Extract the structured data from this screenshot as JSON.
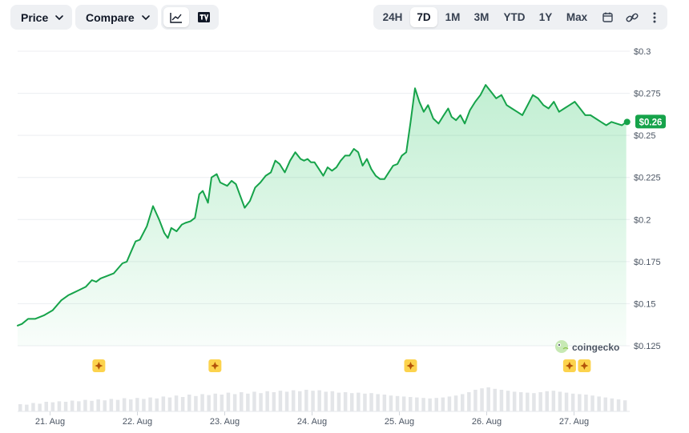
{
  "toolbar": {
    "price_label": "Price",
    "compare_label": "Compare",
    "ranges": [
      "24H",
      "7D",
      "1M",
      "3M",
      "YTD",
      "1Y",
      "Max"
    ],
    "active_range": "7D"
  },
  "icons": [
    "chevron-down-icon",
    "line-chart-icon",
    "tradingview-icon",
    "calendar-icon",
    "link-icon",
    "more-vertical-icon",
    "coingecko-logo-icon",
    "event-star-icon"
  ],
  "colors": {
    "line": "#16a34a",
    "fill": "#22c55e",
    "badge": "#16a34a"
  },
  "watermark": "coingecko",
  "current_price_label": "$0.26",
  "chart_data": {
    "type": "area",
    "ylim": [
      0.125,
      0.3
    ],
    "y_ticks": [
      {
        "value": 0.3,
        "label": "$0.3"
      },
      {
        "value": 0.275,
        "label": "$0.275"
      },
      {
        "value": 0.25,
        "label": "$0.25"
      },
      {
        "value": 0.225,
        "label": "$0.225"
      },
      {
        "value": 0.2,
        "label": "$0.2"
      },
      {
        "value": 0.175,
        "label": "$0.175"
      },
      {
        "value": 0.15,
        "label": "$0.15"
      },
      {
        "value": 0.125,
        "label": "$0.125"
      }
    ],
    "x_ticks": [
      {
        "value": 0.5,
        "label": "21. Aug"
      },
      {
        "value": 1.5,
        "label": "22. Aug"
      },
      {
        "value": 2.5,
        "label": "23. Aug"
      },
      {
        "value": 3.5,
        "label": "24. Aug"
      },
      {
        "value": 4.5,
        "label": "25. Aug"
      },
      {
        "value": 5.5,
        "label": "26. Aug"
      },
      {
        "value": 6.5,
        "label": "27. Aug"
      }
    ],
    "xlim": [
      0,
      7.0
    ],
    "series": [
      {
        "x": [
          0,
          0.05,
          0.12,
          0.2,
          0.3,
          0.4,
          0.5,
          0.58,
          0.62,
          0.7,
          0.78,
          0.85,
          0.9,
          0.95,
          1.0,
          1.05,
          1.1,
          1.2,
          1.25,
          1.3,
          1.35,
          1.4,
          1.48,
          1.55,
          1.62,
          1.68,
          1.72,
          1.76,
          1.82,
          1.88,
          1.92,
          1.98,
          2.03,
          2.08,
          2.12,
          2.18,
          2.22,
          2.28,
          2.32,
          2.36,
          2.4,
          2.45,
          2.5,
          2.55,
          2.6,
          2.66,
          2.72,
          2.78,
          2.84,
          2.9,
          2.95,
          3.0,
          3.06,
          3.12,
          3.18,
          3.24,
          3.28,
          3.32,
          3.36,
          3.4,
          3.45,
          3.5,
          3.55,
          3.6,
          3.65,
          3.7,
          3.75,
          3.8,
          3.85,
          3.9,
          3.95,
          4.0,
          4.05,
          4.1,
          4.15,
          4.2,
          4.25,
          4.3,
          4.35,
          4.4,
          4.45,
          4.5,
          4.55,
          4.6,
          4.65,
          4.7,
          4.76,
          4.82,
          4.88,
          4.93,
          4.97,
          5.02,
          5.07,
          5.12,
          5.18,
          5.24,
          5.3,
          5.36,
          5.42,
          5.48,
          5.54,
          5.6,
          5.66,
          5.72,
          5.78,
          5.84,
          5.9,
          5.96,
          6.02,
          6.08,
          6.14,
          6.2,
          6.26,
          6.32,
          6.38,
          6.44,
          6.5,
          6.56,
          6.62,
          6.68,
          6.74,
          6.8,
          6.86,
          6.92,
          6.97
        ],
        "y": [
          0.137,
          0.138,
          0.141,
          0.141,
          0.143,
          0.146,
          0.152,
          0.155,
          0.156,
          0.158,
          0.16,
          0.164,
          0.163,
          0.165,
          0.166,
          0.167,
          0.168,
          0.174,
          0.175,
          0.181,
          0.187,
          0.188,
          0.196,
          0.208,
          0.2,
          0.192,
          0.189,
          0.195,
          0.193,
          0.197,
          0.198,
          0.199,
          0.201,
          0.215,
          0.217,
          0.21,
          0.225,
          0.227,
          0.222,
          0.221,
          0.22,
          0.223,
          0.221,
          0.214,
          0.207,
          0.211,
          0.219,
          0.222,
          0.226,
          0.228,
          0.235,
          0.233,
          0.228,
          0.235,
          0.24,
          0.236,
          0.235,
          0.236,
          0.234,
          0.234,
          0.23,
          0.226,
          0.231,
          0.229,
          0.231,
          0.235,
          0.238,
          0.238,
          0.242,
          0.24,
          0.232,
          0.236,
          0.23,
          0.226,
          0.224,
          0.224,
          0.228,
          0.232,
          0.233,
          0.238,
          0.24,
          0.258,
          0.278,
          0.27,
          0.264,
          0.268,
          0.26,
          0.257,
          0.262,
          0.266,
          0.261,
          0.259,
          0.262,
          0.257,
          0.265,
          0.27,
          0.274,
          0.28,
          0.276,
          0.272,
          0.274,
          0.268,
          0.266,
          0.264,
          0.262,
          0.268,
          0.274,
          0.272,
          0.268,
          0.266,
          0.27,
          0.264,
          0.266,
          0.268,
          0.27,
          0.266,
          0.262,
          0.262,
          0.26,
          0.258,
          0.256,
          0.258,
          0.257,
          0.256,
          0.258
        ]
      }
    ],
    "volume": [
      0.3,
      0.28,
      0.35,
      0.32,
      0.4,
      0.38,
      0.42,
      0.4,
      0.45,
      0.42,
      0.48,
      0.44,
      0.5,
      0.46,
      0.52,
      0.48,
      0.55,
      0.5,
      0.56,
      0.52,
      0.58,
      0.54,
      0.62,
      0.58,
      0.66,
      0.6,
      0.7,
      0.64,
      0.72,
      0.68,
      0.74,
      0.7,
      0.78,
      0.72,
      0.8,
      0.74,
      0.82,
      0.76,
      0.84,
      0.8,
      0.86,
      0.82,
      0.88,
      0.84,
      0.9,
      0.86,
      0.88,
      0.82,
      0.84,
      0.78,
      0.8,
      0.76,
      0.78,
      0.74,
      0.76,
      0.72,
      0.7,
      0.66,
      0.64,
      0.62,
      0.6,
      0.58,
      0.56,
      0.54,
      0.56,
      0.58,
      0.62,
      0.66,
      0.72,
      0.8,
      0.9,
      0.96,
      1.0,
      0.94,
      0.9,
      0.86,
      0.82,
      0.8,
      0.78,
      0.76,
      0.8,
      0.84,
      0.86,
      0.82,
      0.78,
      0.74,
      0.72,
      0.7,
      0.66,
      0.62,
      0.58,
      0.54,
      0.5,
      0.46
    ],
    "events_x": [
      0.93,
      2.26,
      4.5,
      6.32,
      6.49
    ],
    "grid": true,
    "legend": "none"
  }
}
